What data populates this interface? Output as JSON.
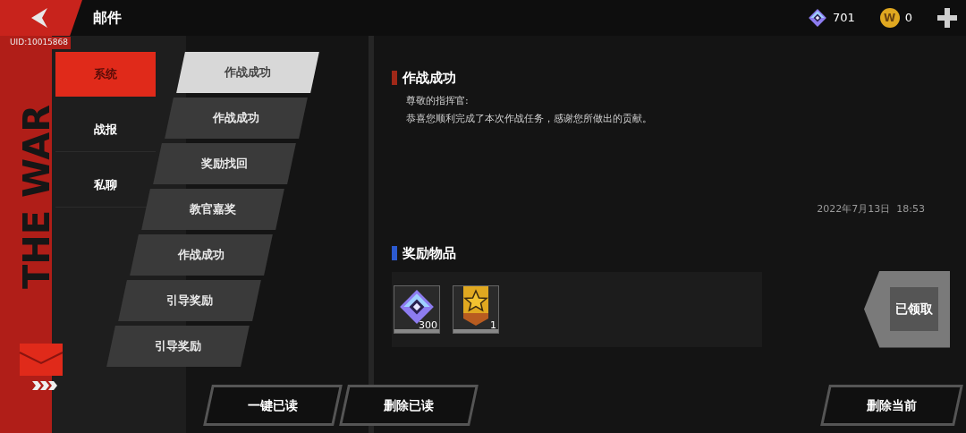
{
  "header": {
    "title": "邮件",
    "uid": "UID:10015868",
    "currencies": [
      {
        "kind": "gem",
        "amount": "701"
      },
      {
        "kind": "coin",
        "symbol": "W",
        "amount": "0"
      }
    ]
  },
  "decor_text": "THE WAR",
  "categories": [
    {
      "label": "系统",
      "selected": true
    },
    {
      "label": "战报",
      "selected": false
    },
    {
      "label": "私聊",
      "selected": false
    }
  ],
  "mails": [
    {
      "title": "作战成功",
      "selected": true
    },
    {
      "title": "作战成功",
      "selected": false
    },
    {
      "title": "奖励找回",
      "selected": false
    },
    {
      "title": "教官嘉奖",
      "selected": false
    },
    {
      "title": "作战成功",
      "selected": false
    },
    {
      "title": "引导奖励",
      "selected": false
    },
    {
      "title": "引导奖励",
      "selected": false
    }
  ],
  "mail": {
    "title": "作战成功",
    "greeting": "尊敬的指挥官:",
    "body": "恭喜您顺利完成了本次作战任务，感谢您所做出的贡献。",
    "date": "2022年7月13日  18:53"
  },
  "rewards": {
    "title": "奖励物品",
    "items": [
      {
        "kind": "gem",
        "count": "300"
      },
      {
        "kind": "medal",
        "count": "1"
      }
    ],
    "claim_label": "已领取",
    "claimed": true
  },
  "buttons": {
    "read_all": "一键已读",
    "delete_read": "删除已读",
    "delete_current": "删除当前"
  }
}
